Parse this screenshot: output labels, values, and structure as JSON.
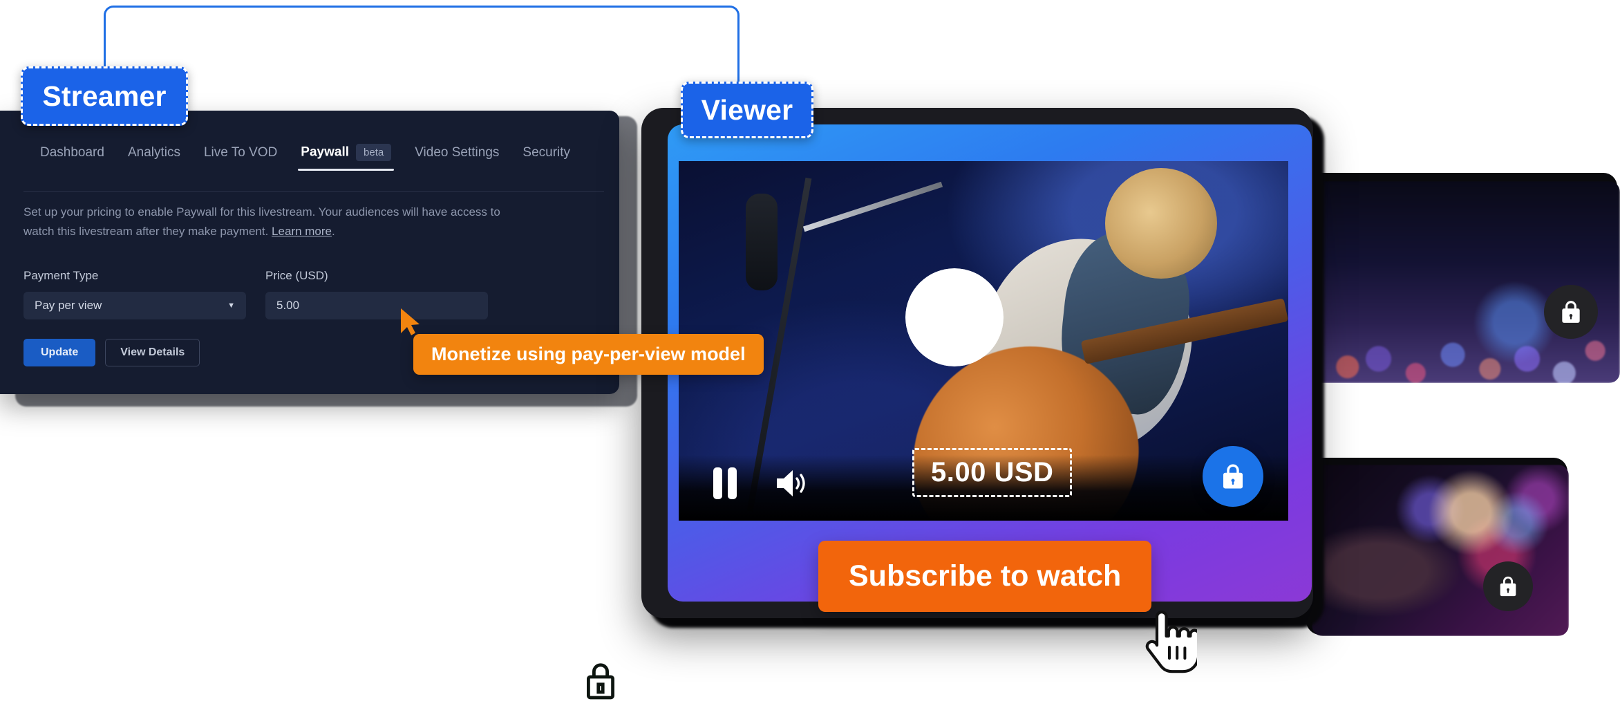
{
  "annotations": {
    "streamer_badge": "Streamer",
    "viewer_badge": "Viewer",
    "tooltip": "Monetize using pay-per-view model"
  },
  "dashboard": {
    "tabs": [
      {
        "label": "Dashboard",
        "active": false
      },
      {
        "label": "Analytics",
        "active": false
      },
      {
        "label": "Live To VOD",
        "active": false
      },
      {
        "label": "Paywall",
        "active": true,
        "badge": "beta"
      },
      {
        "label": "Video Settings",
        "active": false
      },
      {
        "label": "Security",
        "active": false
      }
    ],
    "description_line1": "Set up your pricing to enable Paywall for this livestream. Your audiences will have access",
    "description_line2": "to watch this livestream after they make payment.",
    "learn_more": "Learn more",
    "description_period": ".",
    "payment_type_label": "Payment Type",
    "payment_type_value": "Pay per view",
    "price_label": "Price (USD)",
    "price_value": "5.00",
    "update_button": "Update",
    "view_details_button": "View Details"
  },
  "player": {
    "price_badge": "5.00 USD",
    "subscribe_button": "Subscribe to watch",
    "pause_icon": "pause-icon",
    "volume_icon": "volume-icon",
    "play_icon": "play-icon",
    "lock_icon": "lock-icon"
  },
  "thumbnails": [
    {
      "lock_icon": "lock-icon"
    },
    {
      "lock_icon": "lock-icon"
    }
  ],
  "colors": {
    "badge_blue": "#1B63E8",
    "accent_orange": "#F2840F",
    "subscribe_orange": "#F2650C",
    "panel_bg": "#151C30",
    "primary_button": "#1A5CC4",
    "lock_button_blue": "#1B73E8"
  }
}
